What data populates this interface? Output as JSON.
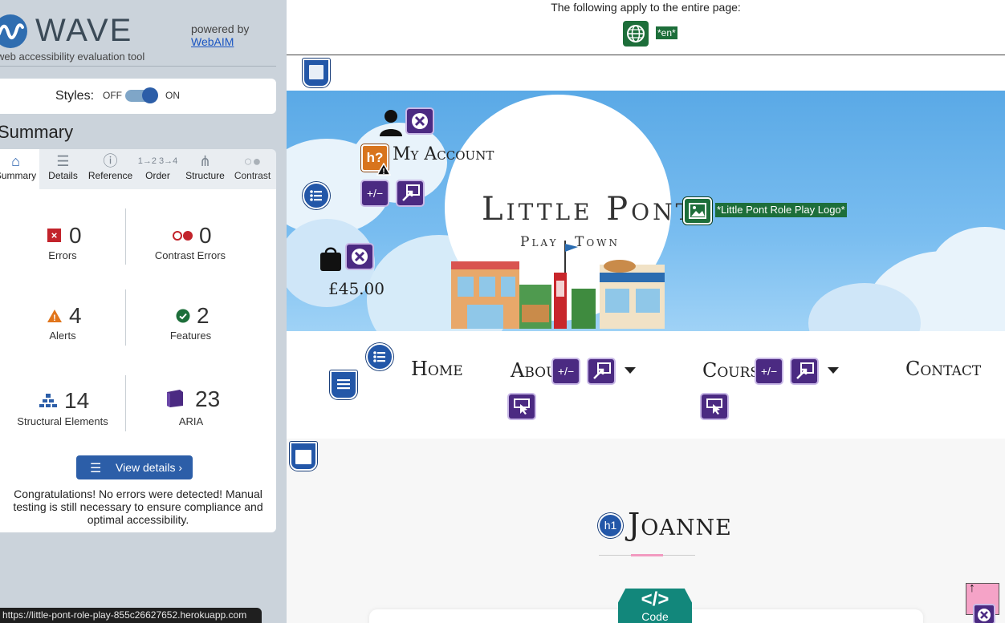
{
  "sidebar": {
    "logo_word": "WAVE",
    "logo_subtitle": "web accessibility evaluation tool",
    "powered_by": "powered by",
    "powered_link": "WebAIM",
    "styles_label": "Styles:",
    "toggle_off": "OFF",
    "toggle_on": "ON",
    "toggle_state": "on",
    "summary_heading": "Summary",
    "tabs": [
      {
        "label": "Summary",
        "icon": "home-icon",
        "active": true
      },
      {
        "label": "Details",
        "icon": "list-icon",
        "active": false
      },
      {
        "label": "Reference",
        "icon": "info-icon",
        "active": false
      },
      {
        "label": "Order",
        "icon": "order-icon",
        "active": false
      },
      {
        "label": "Structure",
        "icon": "structure-icon",
        "active": false
      },
      {
        "label": "Contrast",
        "icon": "contrast-icon",
        "active": false
      }
    ],
    "stats": {
      "errors": {
        "count": "0",
        "label": "Errors"
      },
      "contrast_errors": {
        "count": "0",
        "label": "Contrast Errors"
      },
      "alerts": {
        "count": "4",
        "label": "Alerts"
      },
      "features": {
        "count": "2",
        "label": "Features"
      },
      "structural": {
        "count": "14",
        "label": "Structural Elements"
      },
      "aria": {
        "count": "23",
        "label": "ARIA"
      }
    },
    "view_details": "View details ›",
    "congrats": "Congratulations! No errors were detected! Manual testing is still necessary to ensure compliance and optimal accessibility."
  },
  "status_url": "https://little-pont-role-play-855c26627652.herokuapp.com",
  "page": {
    "applies_text": "The following apply to the entire page:",
    "lang_tag": "*en*",
    "hero_title": "Little Pont",
    "hero_sub_left": "Play",
    "hero_sub_right": "Town",
    "my_account": "My Account",
    "price": "£45.00",
    "logo_alt": "*Little Pont Role Play Logo*",
    "nav": {
      "home": "Home",
      "about": "About",
      "courses": "Courses",
      "contact": "Contact",
      "aria_expanded_label": "+/−"
    },
    "h1_badge": "h1",
    "h1_text": "Joanne",
    "code_symbol": "</>",
    "code_label": "Code"
  },
  "colors": {
    "wave_blue": "#2c5ea8",
    "aria_purple": "#4b2a82",
    "feature_green": "#1d6e3a",
    "alert_orange": "#e1751b",
    "error_red": "#c2232b",
    "code_teal": "#12877b"
  }
}
